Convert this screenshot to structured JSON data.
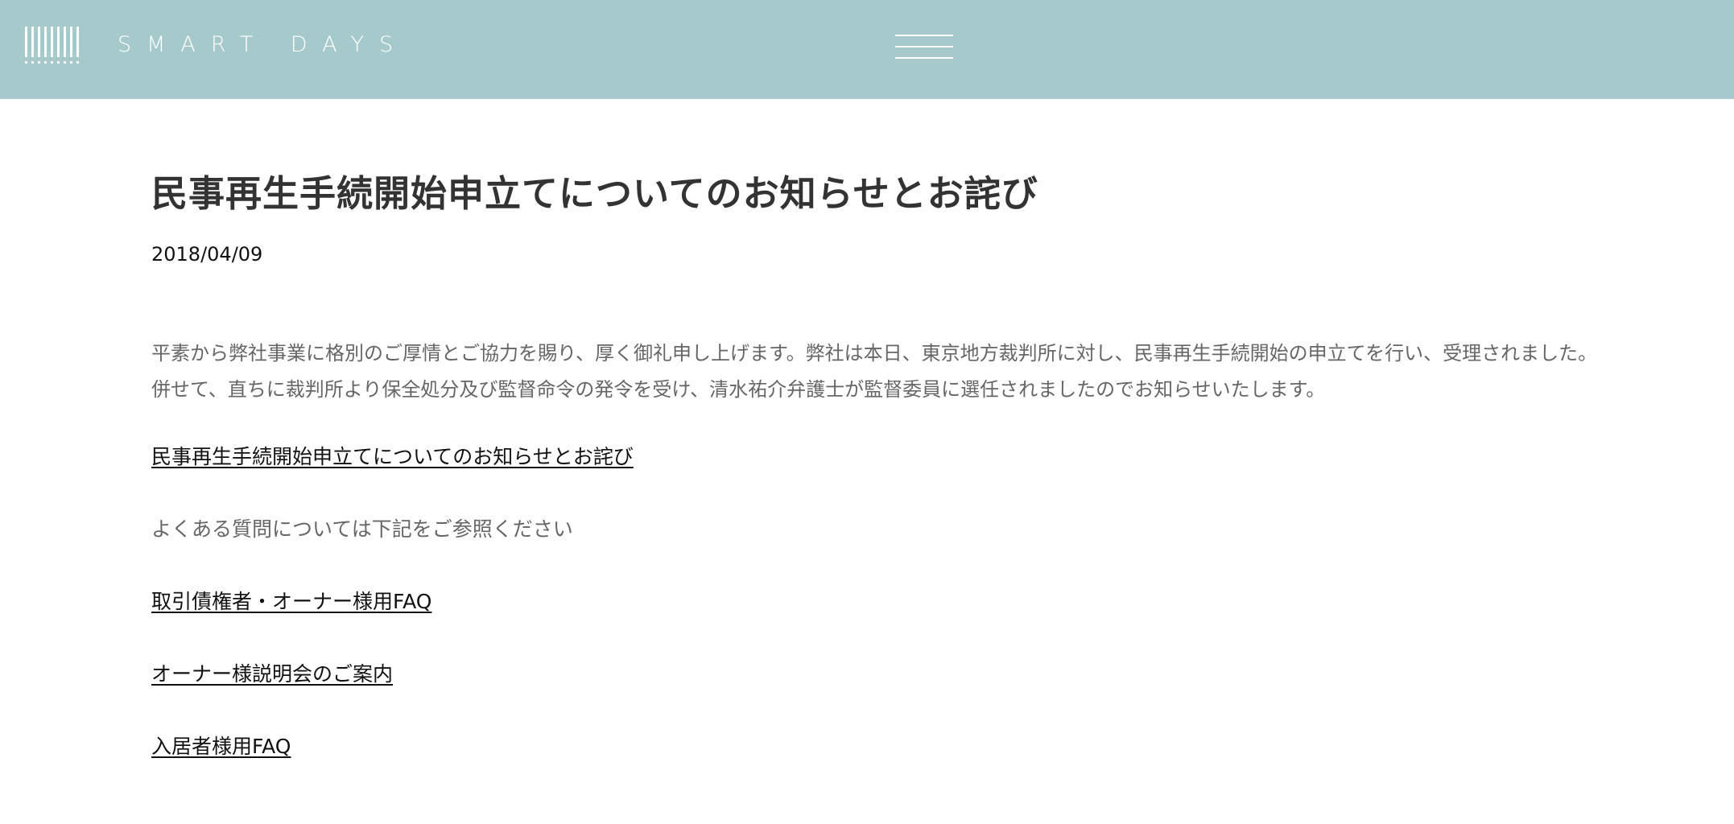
{
  "header": {
    "brand": "SMART DAYS",
    "logo_icon": "barcode-stripes-icon",
    "menu_icon": "hamburger-menu-icon",
    "background_color": "#a6cacb"
  },
  "article": {
    "title": "民事再生手続開始申立てについてのお知らせとお詫び",
    "date": "2018/04/09",
    "paragraph_lines": [
      "平素から弊社事業に格別のご厚情とご協力を賜り、厚く御礼申し上げます。弊社は本日、東京地方裁判所に対し、民事再生手続開始の申立てを行い、受理されました。",
      "併せて、直ちに裁判所より保全処分及び監督命令の発令を受け、清水祐介弁護士が監督委員に選任されましたのでお知らせいたします。"
    ],
    "notice_link": "民事再生手続開始申立てについてのお知らせとお詫び",
    "faq_note": "よくある質問については下記をご参照ください",
    "faq_links": [
      "取引債権者・オーナー様用FAQ",
      "オーナー様説明会のご案内",
      "入居者様用FAQ"
    ]
  }
}
